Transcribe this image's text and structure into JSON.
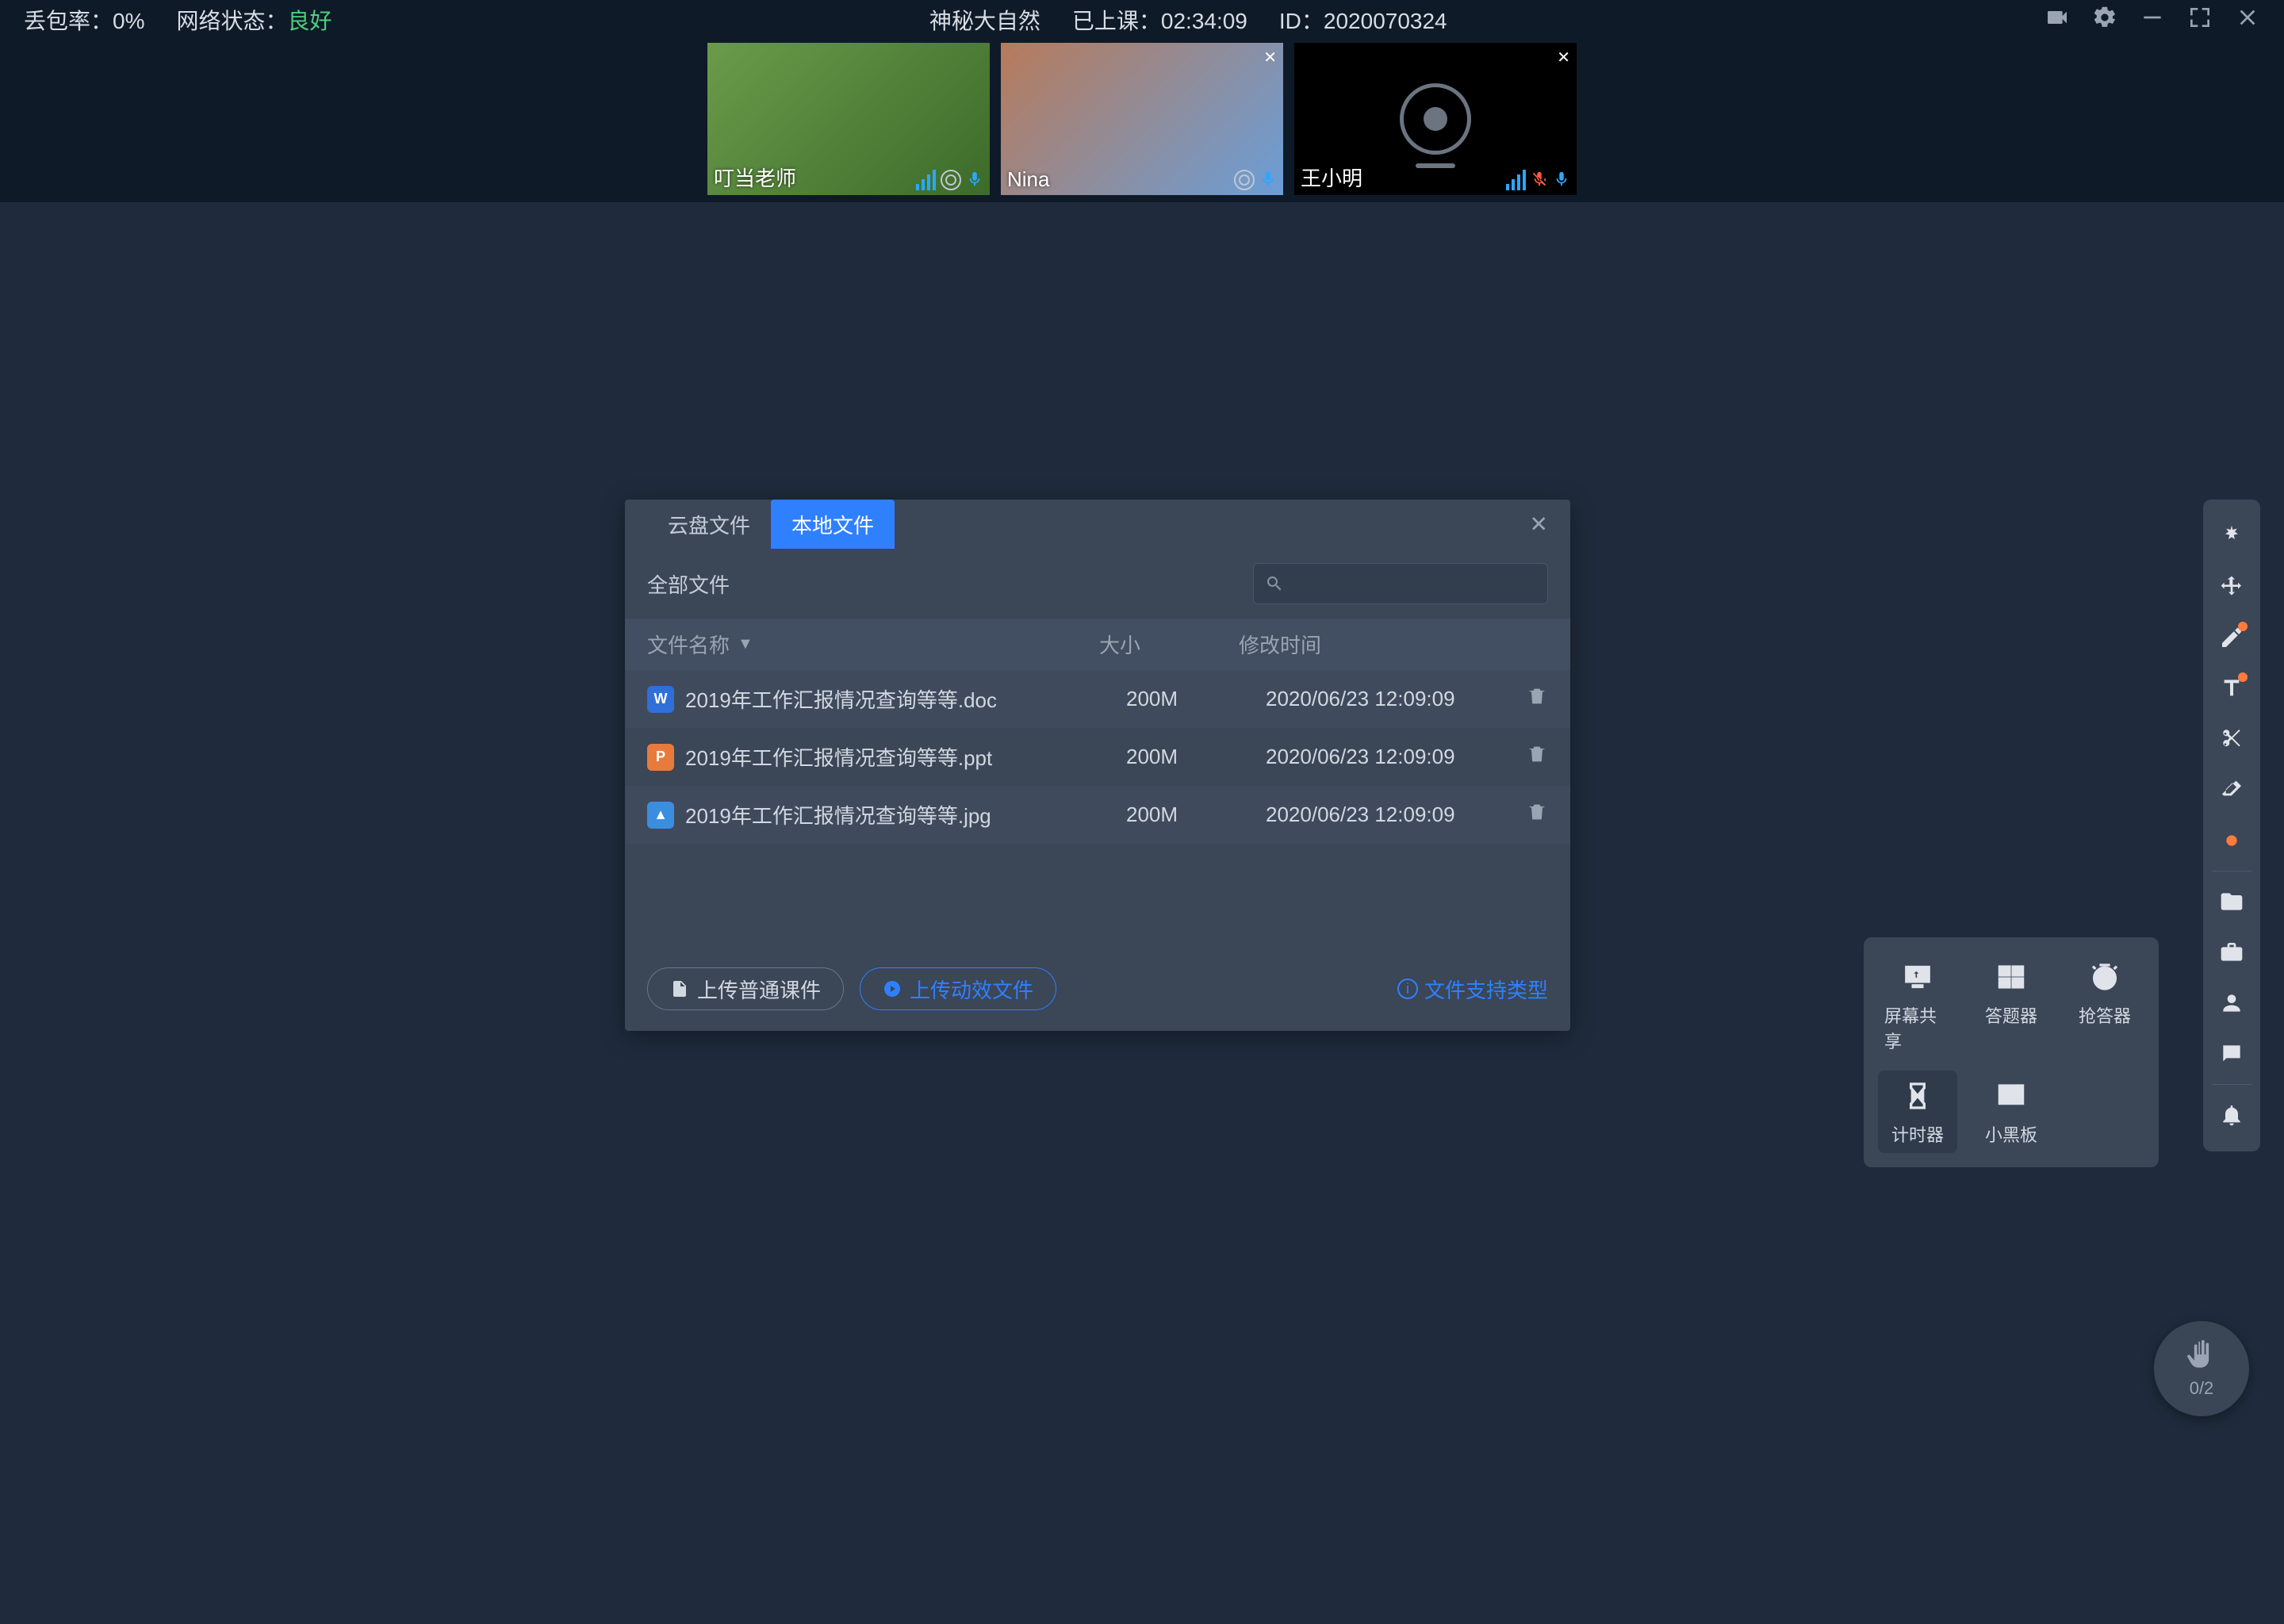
{
  "topbar": {
    "loss_label": "丢包率：",
    "loss_value": "0%",
    "net_label": "网络状态：",
    "net_value": "良好",
    "title": "神秘大自然",
    "time_label": "已上课：",
    "time_value": "02:34:09",
    "id_label": "ID：",
    "id_value": "2020070324"
  },
  "participants": [
    {
      "name": "叮当老师",
      "closeable": false,
      "mic_muted": false
    },
    {
      "name": "Nina",
      "closeable": true,
      "mic_muted": false
    },
    {
      "name": "王小明",
      "closeable": true,
      "mic_muted": true,
      "cam_off": true
    }
  ],
  "dialog": {
    "tabs": [
      "云盘文件",
      "本地文件"
    ],
    "active_tab": 1,
    "all_files": "全部文件",
    "col_name": "文件名称",
    "col_size": "大小",
    "col_time": "修改时间",
    "files": [
      {
        "icon": "w",
        "name": "2019年工作汇报情况查询等等.doc",
        "size": "200M",
        "time": "2020/06/23 12:09:09"
      },
      {
        "icon": "p",
        "name": "2019年工作汇报情况查询等等.ppt",
        "size": "200M",
        "time": "2020/06/23 12:09:09"
      },
      {
        "icon": "i",
        "name": "2019年工作汇报情况查询等等.jpg",
        "size": "200M",
        "time": "2020/06/23 12:09:09"
      }
    ],
    "btn_upload_normal": "上传普通课件",
    "btn_upload_anim": "上传动效文件",
    "link_support": "文件支持类型"
  },
  "tools_popup": [
    {
      "key": "screen",
      "label": "屏幕共享"
    },
    {
      "key": "answer",
      "label": "答题器"
    },
    {
      "key": "rush",
      "label": "抢答器"
    },
    {
      "key": "timer",
      "label": "计时器",
      "active": true
    },
    {
      "key": "board",
      "label": "小黑板"
    }
  ],
  "hand": {
    "count": "0/2"
  }
}
